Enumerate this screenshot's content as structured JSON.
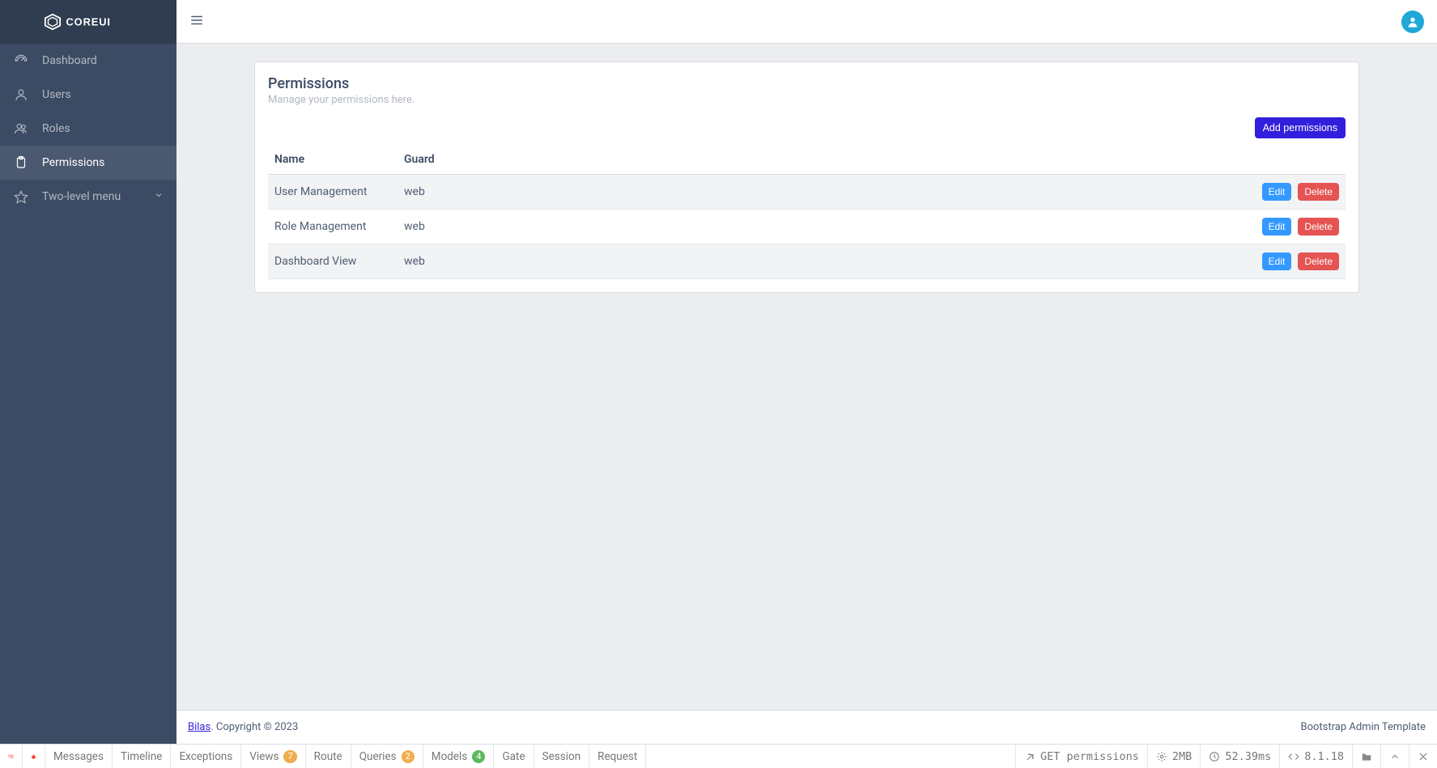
{
  "brand": "COREUI",
  "sidebar": {
    "items": [
      {
        "label": "Dashboard",
        "icon": "speedometer",
        "active": false
      },
      {
        "label": "Users",
        "icon": "user",
        "active": false
      },
      {
        "label": "Roles",
        "icon": "users",
        "active": false
      },
      {
        "label": "Permissions",
        "icon": "clipboard",
        "active": true
      },
      {
        "label": "Two-level menu",
        "icon": "star",
        "active": false,
        "chevron": true
      }
    ]
  },
  "page": {
    "title": "Permissions",
    "subtitle": "Manage your permissions here.",
    "add_button": "Add permissions",
    "columns": {
      "name": "Name",
      "guard": "Guard"
    },
    "edit_label": "Edit",
    "delete_label": "Delete",
    "rows": [
      {
        "name": "User Management",
        "guard": "web"
      },
      {
        "name": "Role Management",
        "guard": "web"
      },
      {
        "name": "Dashboard View",
        "guard": "web"
      }
    ]
  },
  "footer": {
    "link": "Bilas",
    "text": ". Copyright © 2023",
    "right": "Bootstrap Admin Template"
  },
  "debugbar": {
    "left": [
      {
        "label": "Messages"
      },
      {
        "label": "Timeline"
      },
      {
        "label": "Exceptions"
      },
      {
        "label": "Views",
        "badge": "7",
        "badge_class": "badge-orange"
      },
      {
        "label": "Route"
      },
      {
        "label": "Queries",
        "badge": "2",
        "badge_class": "badge-orange"
      },
      {
        "label": "Models",
        "badge": "4",
        "badge_class": "badge-green"
      },
      {
        "label": "Gate"
      },
      {
        "label": "Session"
      },
      {
        "label": "Request"
      }
    ],
    "route_method": "GET permissions",
    "memory": "2MB",
    "time": "52.39ms",
    "php": "8.1.18"
  }
}
